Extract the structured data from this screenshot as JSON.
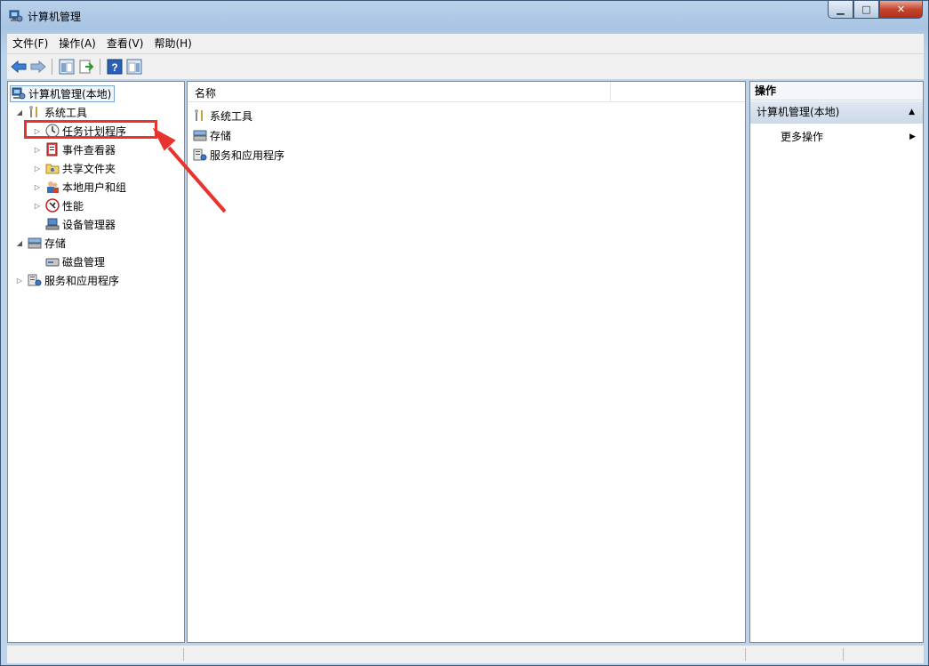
{
  "window": {
    "title": "计算机管理"
  },
  "menu": [
    "文件(F)",
    "操作(A)",
    "查看(V)",
    "帮助(H)"
  ],
  "toolbar": [
    "back-icon",
    "forward-icon",
    "show-hide-tree-icon",
    "export-list-icon",
    "help-icon",
    "show-hide-action-pane-icon"
  ],
  "tree": {
    "root": "计算机管理(本地)",
    "system_tools": "系统工具",
    "task_scheduler": "任务计划程序",
    "event_viewer": "事件查看器",
    "shared_folders": "共享文件夹",
    "local_users": "本地用户和组",
    "performance": "性能",
    "device_manager": "设备管理器",
    "storage": "存储",
    "disk_management": "磁盘管理",
    "services_apps": "服务和应用程序"
  },
  "list": {
    "column_name": "名称",
    "rows": [
      "系统工具",
      "存储",
      "服务和应用程序"
    ]
  },
  "actions": {
    "header": "操作",
    "group": "计算机管理(本地)",
    "more": "更多操作"
  },
  "colors": {
    "highlight": "#e8332e",
    "selection_border": "#7da2ce"
  }
}
